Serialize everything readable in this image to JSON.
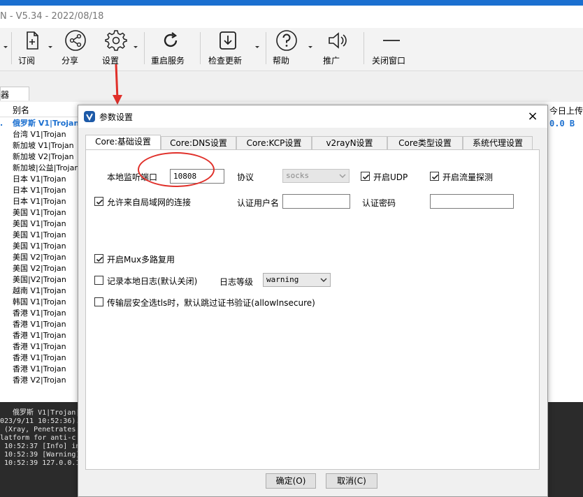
{
  "window": {
    "title_fragment": "N - V5.34 - 2022/08/18"
  },
  "toolbar": {
    "items": [
      {
        "label": "订阅",
        "icon": "subscribe-icon"
      },
      {
        "label": "分享",
        "icon": "share-icon"
      },
      {
        "label": "设置",
        "icon": "gear-icon"
      },
      {
        "label": "重启服务",
        "icon": "restart-icon"
      },
      {
        "label": "检查更新",
        "icon": "download-icon"
      },
      {
        "label": "帮助",
        "icon": "help-icon"
      },
      {
        "label": "推广",
        "icon": "speaker-icon"
      },
      {
        "label": "关闭窗口",
        "icon": "minimize-icon"
      }
    ]
  },
  "side_tab": {
    "label": "器"
  },
  "server_list": {
    "header": "别名",
    "rows": [
      {
        "mark": ".",
        "name": "俄罗斯 V1|Trojan"
      },
      {
        "mark": "",
        "name": "台湾 V1|Trojan"
      },
      {
        "mark": "",
        "name": "新加坡 V1|Trojan"
      },
      {
        "mark": "",
        "name": "新加坡 V2|Trojan"
      },
      {
        "mark": "",
        "name": "新加坡|公益|Trojan"
      },
      {
        "mark": "",
        "name": "日本 V1|Trojan"
      },
      {
        "mark": "",
        "name": "日本 V1|Trojan"
      },
      {
        "mark": "",
        "name": "日本 V1|Trojan"
      },
      {
        "mark": "",
        "name": "美国  V1|Trojan"
      },
      {
        "mark": "",
        "name": "美国 V1|Trojan"
      },
      {
        "mark": "",
        "name": "美国 V1|Trojan"
      },
      {
        "mark": "",
        "name": "美国 V1|Trojan"
      },
      {
        "mark": "",
        "name": "美国 V2|Trojan"
      },
      {
        "mark": "",
        "name": "美国 V2|Trojan"
      },
      {
        "mark": "",
        "name": "美国|V2|Trojan"
      },
      {
        "mark": "",
        "name": "越南 V1|Trojan"
      },
      {
        "mark": "",
        "name": "韩国 V1|Trojan"
      },
      {
        "mark": "",
        "name": "香港 V1|Trojan"
      },
      {
        "mark": "",
        "name": "香港 V1|Trojan"
      },
      {
        "mark": "",
        "name": "香港 V1|Trojan"
      },
      {
        "mark": "",
        "name": "香港 V1|Trojan"
      },
      {
        "mark": "",
        "name": "香港 V1|Trojan"
      },
      {
        "mark": "",
        "name": "香港 V1|Trojan"
      },
      {
        "mark": "",
        "name": "香港 V2|Trojan"
      }
    ]
  },
  "right_column": {
    "header": "今日上传",
    "value": "0.0 B"
  },
  "log": {
    "lines": [
      "   俄罗斯 V1|Trojan|",
      "023/9/11 10:52:36).",
      " (Xray, Penetrates",
      "latform for anti-c",
      " 10:52:37 [Info] in",
      " 10:52:39 [Warning]",
      " 10:52:39 127.0.0.1"
    ]
  },
  "dialog": {
    "title": "参数设置",
    "close": "×",
    "tabs": [
      "Core:基础设置",
      "Core:DNS设置",
      "Core:KCP设置",
      "v2rayN设置",
      "Core类型设置",
      "系统代理设置"
    ],
    "active_tab": 0,
    "local_port_label": "本地监听端口",
    "local_port_value": "10808",
    "protocol_label": "协议",
    "protocol_value": "socks",
    "enable_udp_label": "开启UDP",
    "enable_udp": true,
    "enable_sniffing_label": "开启流量探测",
    "enable_sniffing": true,
    "allow_lan_label": "允许来自局域网的连接",
    "allow_lan": true,
    "auth_user_label": "认证用户名",
    "auth_user_value": "",
    "auth_pass_label": "认证密码",
    "auth_pass_value": "",
    "mux_label": "开启Mux多路复用",
    "mux": true,
    "log_label": "记录本地日志(默认关闭)",
    "log": false,
    "log_level_label": "日志等级",
    "log_level_value": "warning",
    "allow_insecure_label": "传输层安全选tls时，默认跳过证书验证(allowInsecure)",
    "allow_insecure": false,
    "ok_label": "确定(O)",
    "cancel_label": "取消(C)"
  },
  "colors": {
    "accent": "#1a6fd0",
    "annotation": "#e0302a",
    "log_bg": "#2b2b2b"
  }
}
